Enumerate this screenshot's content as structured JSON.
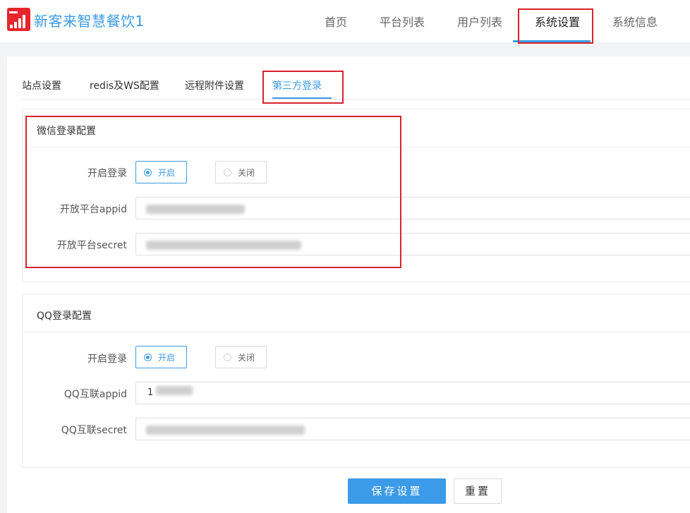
{
  "header": {
    "app_title": "新客来智慧餐饮1",
    "nav": [
      {
        "label": "首页"
      },
      {
        "label": "平台列表"
      },
      {
        "label": "用户列表"
      },
      {
        "label": "系统设置",
        "active": true
      },
      {
        "label": "系统信息"
      }
    ]
  },
  "tabs": [
    {
      "label": "站点设置"
    },
    {
      "label": "redis及WS配置"
    },
    {
      "label": "远程附件设置"
    },
    {
      "label": "第三方登录",
      "active": true
    }
  ],
  "wechat": {
    "title": "微信登录配置",
    "enable_label": "开启登录",
    "on_label": "开启",
    "off_label": "关闭",
    "appid_label": "开放平台appid",
    "secret_label": "开放平台secret",
    "selected": "开启"
  },
  "qq": {
    "title": "QQ登录配置",
    "enable_label": "开启登录",
    "on_label": "开启",
    "off_label": "关闭",
    "appid_label": "QQ互联appid",
    "appid_value": "1",
    "secret_label": "QQ互联secret",
    "selected": "开启"
  },
  "actions": {
    "save_label": "保存设置",
    "reset_label": "重置"
  },
  "colors": {
    "accent": "#3b9be8",
    "highlight": "#d9232d",
    "logo": "#e7262c"
  }
}
